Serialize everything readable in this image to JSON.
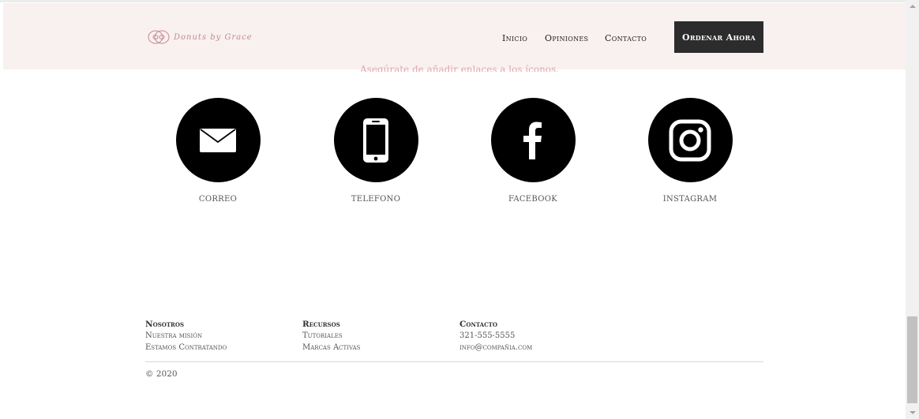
{
  "header": {
    "logo_text": "Donuts by Grace",
    "nav": [
      "Inicio",
      "Opiniones",
      "Contacto"
    ],
    "cta_label": "Ordenar Ahora"
  },
  "contact_section": {
    "subtitle": "Asegúrate de añadir enlaces a los íconos.",
    "items": [
      {
        "label": "CORREO",
        "icon": "mail-icon"
      },
      {
        "label": "TELEFONO",
        "icon": "phone-icon"
      },
      {
        "label": "FACEBOOK",
        "icon": "facebook-icon"
      },
      {
        "label": "INSTAGRAM",
        "icon": "instagram-icon"
      }
    ]
  },
  "footer": {
    "columns": [
      {
        "title": "Nosotros",
        "links": [
          "Nuestra misión",
          "Estamos Contratando"
        ]
      },
      {
        "title": "Recursos",
        "links": [
          "Tutoriales",
          "Marcas Activas"
        ]
      },
      {
        "title": "Contacto",
        "links": [
          "321-555-5555",
          "info@compañia.com"
        ]
      }
    ],
    "copyright": "© 2020"
  },
  "colors": {
    "header_bg": "#f9f0f0",
    "accent_pink": "#e3a6a8",
    "button_bg": "#2c2c2c"
  }
}
